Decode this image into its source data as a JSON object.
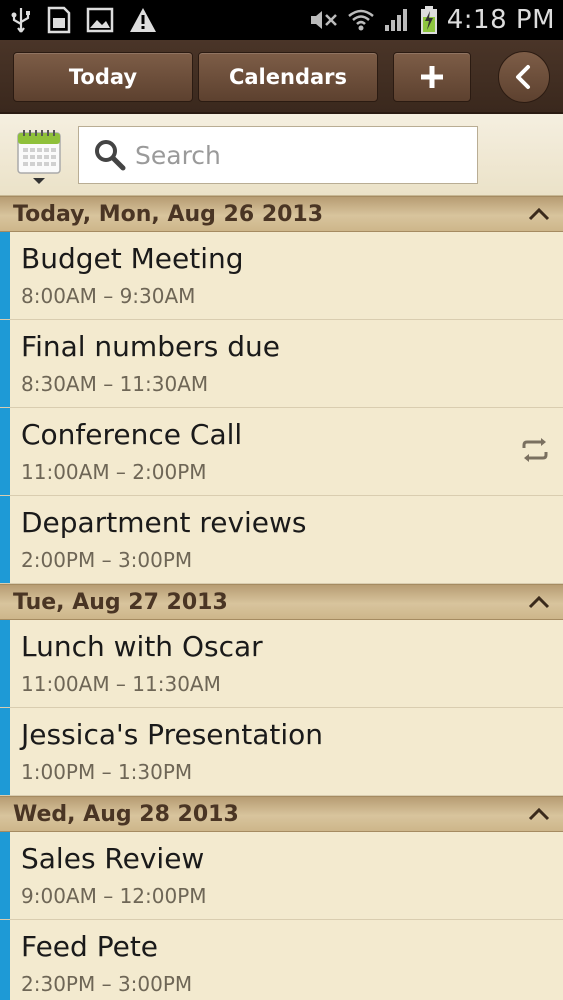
{
  "status_bar": {
    "time": "4:18 PM",
    "left_icons": [
      "usb-icon",
      "sd-card-icon",
      "image-icon",
      "warning-icon"
    ],
    "right_icons": [
      "no-sound-icon",
      "wifi-icon",
      "signal-icon",
      "battery-charging-icon"
    ]
  },
  "toolbar": {
    "today_label": "Today",
    "calendars_label": "Calendars",
    "add_label": "+",
    "back_icon": "back-arrow-icon"
  },
  "search": {
    "placeholder": "Search",
    "value": ""
  },
  "days": [
    {
      "header": "Today, Mon, Aug 26 2013",
      "events": [
        {
          "title": "Budget Meeting",
          "time": "8:00AM – 9:30AM",
          "repeat": false
        },
        {
          "title": "Final numbers due",
          "time": "8:30AM – 11:30AM",
          "repeat": false
        },
        {
          "title": "Conference Call",
          "time": "11:00AM – 2:00PM",
          "repeat": true
        },
        {
          "title": "Department reviews",
          "time": "2:00PM – 3:00PM",
          "repeat": false
        }
      ]
    },
    {
      "header": "Tue, Aug 27 2013",
      "events": [
        {
          "title": "Lunch with Oscar",
          "time": "11:00AM – 11:30AM",
          "repeat": false
        },
        {
          "title": "Jessica's Presentation",
          "time": "1:00PM – 1:30PM",
          "repeat": false
        }
      ]
    },
    {
      "header": "Wed, Aug 28 2013",
      "events": [
        {
          "title": "Sales Review",
          "time": "9:00AM – 12:00PM",
          "repeat": false
        },
        {
          "title": "Feed Pete",
          "time": "2:30PM – 3:00PM",
          "repeat": false
        }
      ]
    }
  ],
  "colors": {
    "event_stripe": "#1e9ad6",
    "toolbar_bg": "#3a281d",
    "list_bg": "#f3eacf",
    "day_header_text": "#4a3524"
  }
}
